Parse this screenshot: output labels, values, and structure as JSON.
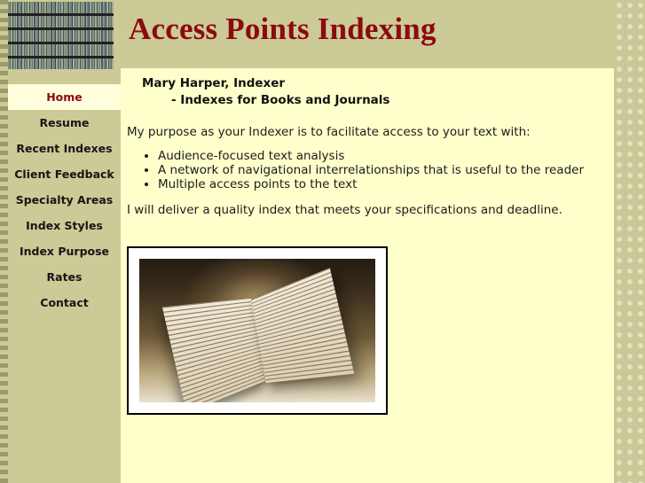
{
  "site": {
    "title": "Access Points Indexing",
    "title_color": "#8b0a10",
    "header_bg": "#ccca96",
    "content_bg": "#ffffcc",
    "sidebar_bg": "#ccca96",
    "active_nav_bg": "#ffffdd"
  },
  "sidebar": {
    "masthead_image_alt": "bookshelf-photo",
    "items": [
      {
        "label": "Home",
        "active": true
      },
      {
        "label": "Resume",
        "active": false
      },
      {
        "label": "Recent Indexes",
        "active": false
      },
      {
        "label": "Client Feedback",
        "active": false
      },
      {
        "label": "Specialty Areas",
        "active": false
      },
      {
        "label": "Index Styles",
        "active": false
      },
      {
        "label": "Index Purpose",
        "active": false
      },
      {
        "label": "Rates",
        "active": false
      },
      {
        "label": "Contact",
        "active": false
      }
    ]
  },
  "main": {
    "heading_line1": "Mary Harper, Indexer",
    "heading_line2": "- Indexes for Books and Journals",
    "intro": "My purpose as your Indexer is to facilitate access to your text with:",
    "bullets": [
      "Audience-focused text analysis",
      "A network of navigational interrelationships that is useful to the reader",
      "Multiple access points to the text"
    ],
    "closing": "I will deliver a quality index that meets your specifications and deadline.",
    "figure_alt": "open-book-photo"
  }
}
